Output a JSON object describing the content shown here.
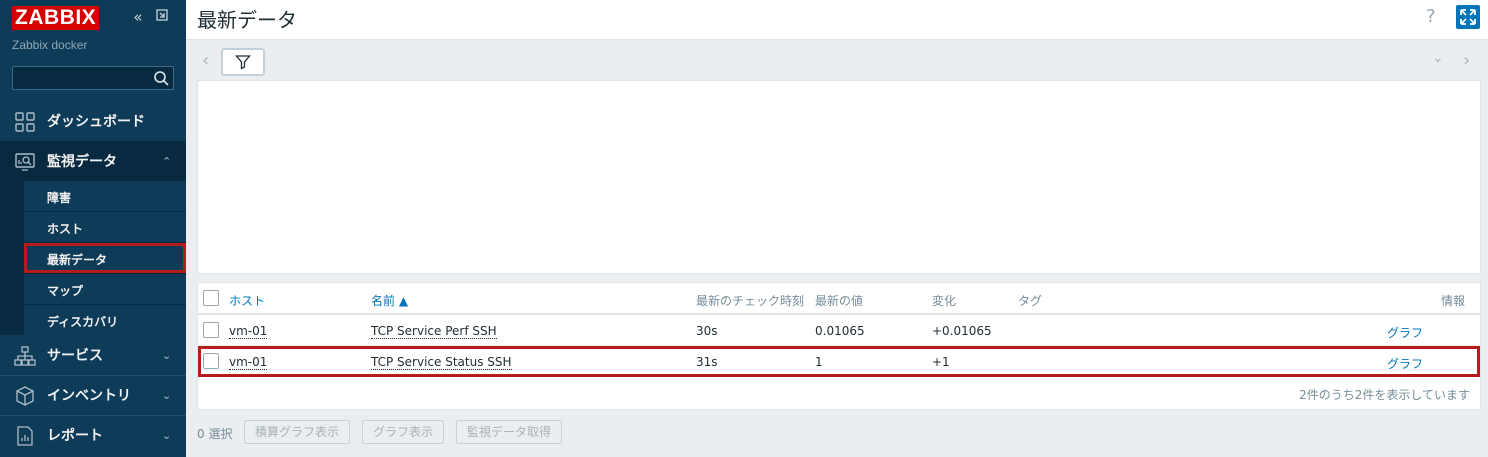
{
  "sidebar": {
    "logo": "ZABBIX",
    "server_name": "Zabbix docker",
    "search_value": "",
    "menu": {
      "dashboard": "ダッシュボード",
      "monitoring": "監視データ",
      "services": "サービス",
      "inventory": "インベントリ",
      "reports": "レポート"
    },
    "submenu": {
      "problems": "障害",
      "hosts": "ホスト",
      "latest_data": "最新データ",
      "maps": "マップ",
      "discovery": "ディスカバリ"
    }
  },
  "header": {
    "title": "最新データ",
    "help": "?"
  },
  "table": {
    "columns": {
      "host": "ホスト",
      "name": "名前 ▲",
      "last_check": "最新のチェック時刻",
      "last_value": "最新の値",
      "change": "変化",
      "tags": "タグ",
      "info": "情報"
    },
    "rows": [
      {
        "host": "vm-01",
        "name": "TCP Service Perf SSH",
        "last_check": "30s",
        "last_value": "0.01065",
        "change": "+0.01065",
        "graph": "グラフ"
      },
      {
        "host": "vm-01",
        "name": "TCP Service Status SSH",
        "last_check": "31s",
        "last_value": "1",
        "change": "+1",
        "graph": "グラフ"
      }
    ],
    "summary": "2件のうち2件を表示しています"
  },
  "footer": {
    "selected": "0 選択",
    "stacked_graph": "積算グラフ表示",
    "graph": "グラフ表示",
    "execute_now": "監視データ取得"
  },
  "colors": {
    "sidebar_bg": "#0e3b57",
    "accent": "#0275b8",
    "logo_red": "#d40000",
    "highlight_red": "#b71c1c"
  }
}
